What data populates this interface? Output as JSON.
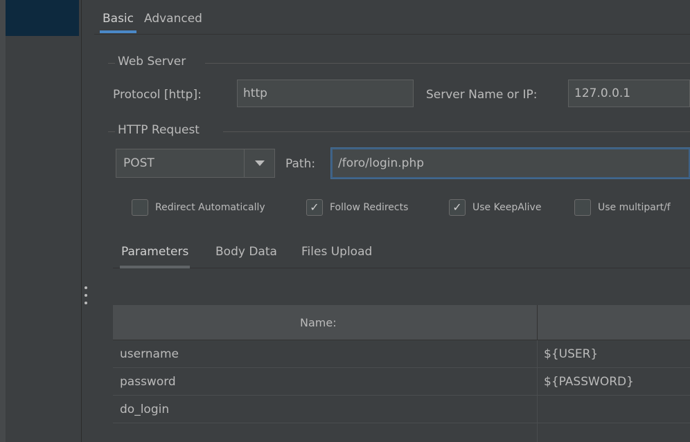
{
  "tabs": {
    "basic": "Basic",
    "advanced": "Advanced"
  },
  "web_server": {
    "title": "Web Server",
    "protocol_label": "Protocol [http]:",
    "protocol_value": "http",
    "server_label": "Server Name or IP:",
    "server_value": "127.0.0.1"
  },
  "http_request": {
    "title": "HTTP Request",
    "method": "POST",
    "path_label": "Path:",
    "path_value": "/foro/login.php"
  },
  "checkboxes": [
    {
      "label": "Redirect Automatically",
      "checked": false
    },
    {
      "label": "Follow Redirects",
      "checked": true
    },
    {
      "label": "Use KeepAlive",
      "checked": true
    },
    {
      "label": "Use multipart/f",
      "checked": false
    }
  ],
  "sub_tabs": {
    "parameters": "Parameters",
    "body_data": "Body Data",
    "files_upload": "Files Upload"
  },
  "table": {
    "header_name": "Name:",
    "rows": [
      {
        "name": "username",
        "value": "${USER}"
      },
      {
        "name": "password",
        "value": "${PASSWORD}"
      },
      {
        "name": "do_login",
        "value": ""
      }
    ]
  },
  "colors": {
    "accent": "#4a88c7",
    "background": "#3c3f41",
    "selected": "#0d293e"
  }
}
